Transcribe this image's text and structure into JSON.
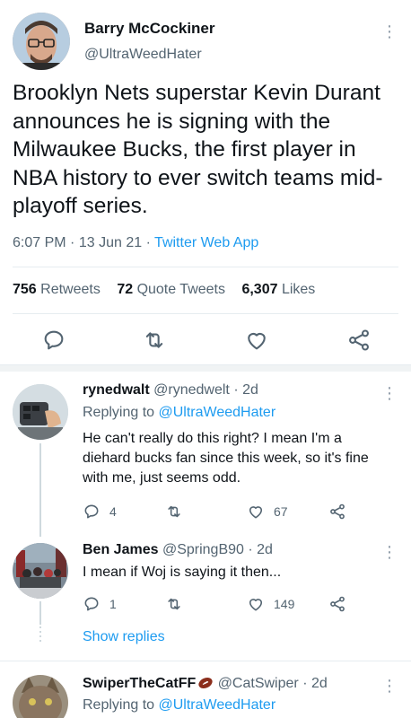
{
  "main_tweet": {
    "author_name": "Barry McCockiner",
    "author_handle": "@UltraWeedHater",
    "text": "Brooklyn Nets superstar Kevin Durant announces he is signing with the Milwaukee Bucks, the first player in NBA history to ever switch teams mid-playoff series.",
    "time": "6:07 PM",
    "date": "13 Jun 21",
    "source": "Twitter Web App",
    "separator": "·",
    "retweets_count": "756",
    "retweets_label": "Retweets",
    "quote_count": "72",
    "quote_label": "Quote Tweets",
    "likes_count": "6,307",
    "likes_label": "Likes"
  },
  "replies": [
    {
      "name": "rynedwalt",
      "handle": "@rynedwelt",
      "age": "2d",
      "replying_label": "Replying to",
      "replying_to": "@UltraWeedHater",
      "text": "He can't really do this right? I mean I'm a diehard bucks fan since this week, so it's fine with me, just seems odd.",
      "reply_count": "4",
      "retweet_count": "",
      "like_count": "67"
    },
    {
      "name": "Ben James",
      "handle": "@SpringB90",
      "age": "2d",
      "text": "I mean if Woj is saying it then...",
      "reply_count": "1",
      "retweet_count": "",
      "like_count": "149"
    },
    {
      "name": "SwiperTheCatFF",
      "handle": "@CatSwiper",
      "age": "2d",
      "replying_label": "Replying to",
      "replying_to": "@UltraWeedHater"
    }
  ],
  "show_replies_label": "Show replies",
  "icons": {
    "reply": "reply-icon",
    "retweet": "retweet-icon",
    "like": "heart-icon",
    "share": "share-icon",
    "more": "more-vertical-icon",
    "football_emoji": "football-emoji-icon"
  },
  "colors": {
    "accent": "#1d9bf0",
    "muted_text": "#536471",
    "divider": "#e6ecf0"
  }
}
